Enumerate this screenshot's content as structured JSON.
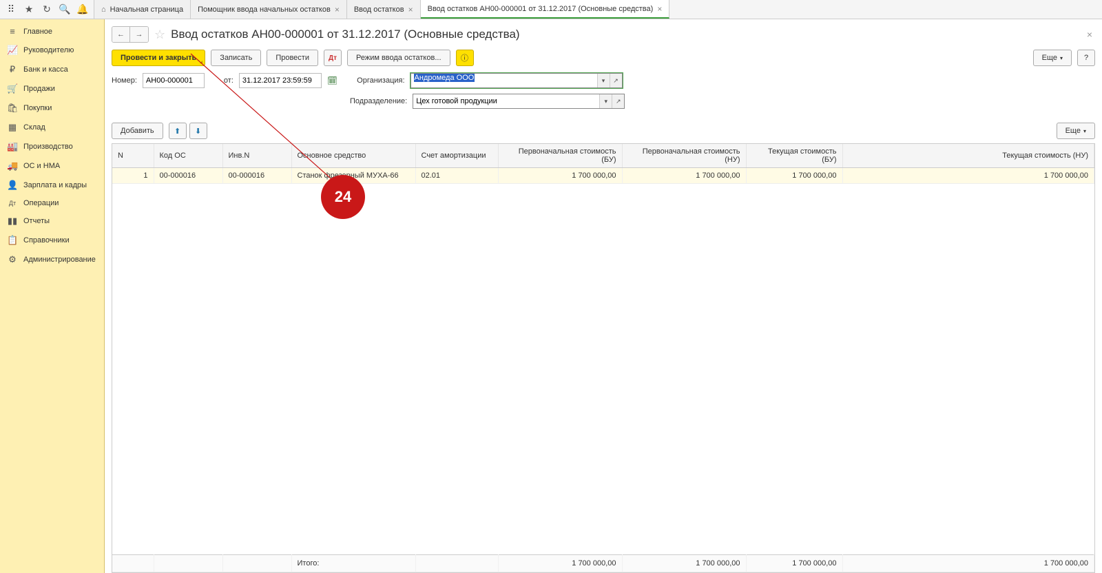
{
  "tabs": {
    "home": "Начальная страница",
    "t1": "Помощник ввода начальных остатков",
    "t2": "Ввод остатков",
    "t3": "Ввод остатков АН00-000001 от 31.12.2017 (Основные средства)"
  },
  "sidebar": {
    "items": [
      {
        "icon": "≡",
        "label": "Главное"
      },
      {
        "icon": "📈",
        "label": "Руководителю"
      },
      {
        "icon": "₽",
        "label": "Банк и касса"
      },
      {
        "icon": "🛒",
        "label": "Продажи"
      },
      {
        "icon": "🛍",
        "label": "Покупки"
      },
      {
        "icon": "▦",
        "label": "Склад"
      },
      {
        "icon": "🏭",
        "label": "Производство"
      },
      {
        "icon": "🚚",
        "label": "ОС и НМА"
      },
      {
        "icon": "👤",
        "label": "Зарплата и кадры"
      },
      {
        "icon": "Дт",
        "label": "Операции"
      },
      {
        "icon": "▮▮",
        "label": "Отчеты"
      },
      {
        "icon": "📋",
        "label": "Справочники"
      },
      {
        "icon": "⚙",
        "label": "Администрирование"
      }
    ]
  },
  "page": {
    "title": "Ввод остатков АН00-000001 от 31.12.2017 (Основные средства)"
  },
  "actions": {
    "post_close": "Провести и закрыть",
    "save": "Записать",
    "post": "Провести",
    "mode": "Режим ввода остатков...",
    "more": "Еще",
    "help": "?"
  },
  "form": {
    "number_label": "Номер:",
    "number": "АН00-000001",
    "from_label": "от:",
    "date": "31.12.2017 23:59:59",
    "org_label": "Организация:",
    "org": "Андромеда ООО",
    "dept_label": "Подразделение:",
    "dept": "Цех готовой продукции"
  },
  "table_toolbar": {
    "add": "Добавить",
    "more": "Еще"
  },
  "columns": {
    "n": "N",
    "code": "Код ОС",
    "inv": "Инв.N",
    "asset": "Основное средство",
    "amort_acc": "Счет амортизации",
    "init_bu": "Первоначальная стоимость (БУ)",
    "init_nu": "Первоначальная стоимость (НУ)",
    "curr_bu": "Текущая стоимость (БУ)",
    "curr_nu": "Текущая стоимость (НУ)"
  },
  "rows": [
    {
      "n": "1",
      "code": "00-000016",
      "inv": "00-000016",
      "asset": "Станок фрезерный МУХА-66",
      "amort_acc": "02.01",
      "init_bu": "1 700 000,00",
      "init_nu": "1 700 000,00",
      "curr_bu": "1 700 000,00",
      "curr_nu": "1 700 000,00"
    }
  ],
  "footer": {
    "total_label": "Итого:",
    "init_bu": "1 700 000,00",
    "init_nu": "1 700 000,00",
    "curr_bu": "1 700 000,00",
    "curr_nu": "1 700 000,00"
  },
  "annotation": {
    "number": "24"
  }
}
